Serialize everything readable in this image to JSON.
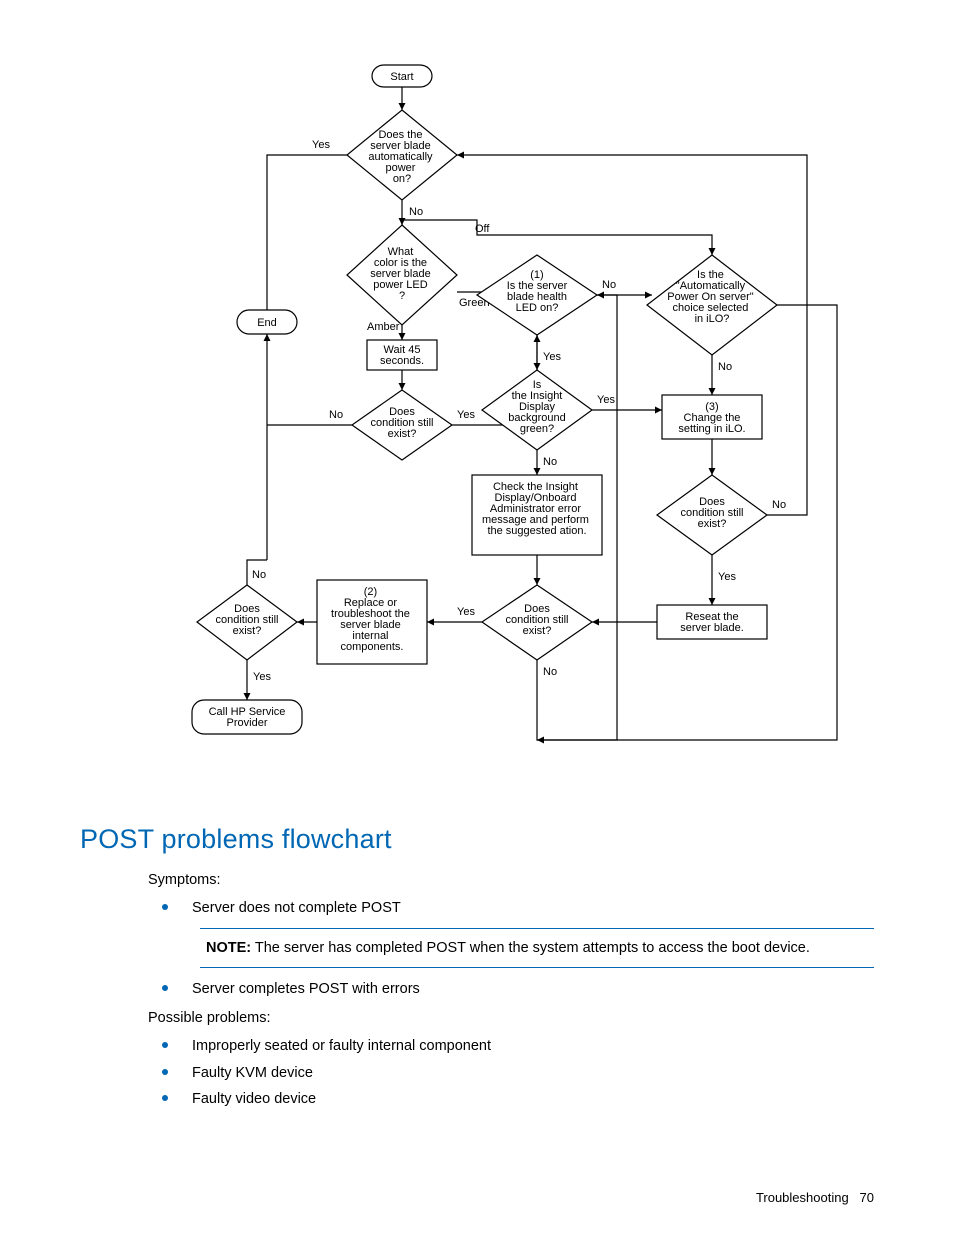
{
  "flow": {
    "start": "Start",
    "q_power_on": "Does the server blade automatically power on?",
    "q_power_on_yes": "Yes",
    "q_power_on_no": "No",
    "q_led_color": "What color is the server blade power LED ?",
    "led_off": "Off",
    "led_green": "Green",
    "led_amber": "Amber",
    "q_health_led": "(1) Is the server blade health LED on?",
    "health_yes": "Yes",
    "health_no": "No",
    "q_auto_ilo": "Is the \"Automatically Power On server\" choice selected in iLO?",
    "ilo_no": "No",
    "change_ilo": "(3) Change the setting in iLO.",
    "q_insight_green": "Is the Insight Display background green?",
    "insight_yes": "Yes",
    "insight_no": "No",
    "check_insight": "Check the Insight Display/Onboard Administrator error message and perform the suggested ation.",
    "q_cond1": "Does condition still exist?",
    "cond_yes": "Yes",
    "cond_no": "No",
    "reseat": "Reseat the server blade.",
    "replace": "(2) Replace or troubleshoot the server blade internal components.",
    "wait45": "Wait 45 seconds.",
    "q_cond2": "Does condition still exist?",
    "q_cond3": "Does condition still exist?",
    "q_cond4": "Does condition still exist?",
    "end": "End",
    "call_hp": "Call HP Service Provider",
    "yes": "Yes",
    "no": "No"
  },
  "section_title": "POST problems flowchart",
  "symptoms_label": "Symptoms:",
  "symptoms": [
    "Server does not complete POST",
    "Server completes POST with errors"
  ],
  "note_label": "NOTE:",
  "note_text": "  The server has completed POST when the system attempts to access the boot device.",
  "possible_label": "Possible problems:",
  "possible": [
    "Improperly seated or faulty internal component",
    "Faulty KVM device",
    "Faulty video device"
  ],
  "footer_section": "Troubleshooting",
  "footer_page": "70",
  "chart_data": {
    "type": "flowchart",
    "nodes": [
      {
        "id": "start",
        "shape": "terminator",
        "label": "Start"
      },
      {
        "id": "q_power_on",
        "shape": "decision",
        "label": "Does the server blade automatically power on?"
      },
      {
        "id": "q_led_color",
        "shape": "decision",
        "label": "What color is the server blade power LED ?"
      },
      {
        "id": "wait45",
        "shape": "process",
        "label": "Wait 45 seconds."
      },
      {
        "id": "q_cond_amber",
        "shape": "decision",
        "label": "Does condition still exist?"
      },
      {
        "id": "q_health_led",
        "shape": "decision",
        "label": "(1) Is the server blade health LED on?"
      },
      {
        "id": "q_auto_ilo",
        "shape": "decision",
        "label": "Is the \"Automatically Power On server\" choice selected in iLO?"
      },
      {
        "id": "change_ilo",
        "shape": "process",
        "label": "(3) Change the setting in iLO."
      },
      {
        "id": "q_cond_ilo",
        "shape": "decision",
        "label": "Does condition still exist?"
      },
      {
        "id": "q_insight_green",
        "shape": "decision",
        "label": "Is the Insight Display background green?"
      },
      {
        "id": "check_insight",
        "shape": "process",
        "label": "Check the Insight Display/Onboard Administrator error message and perform the suggested ation."
      },
      {
        "id": "q_cond_check",
        "shape": "decision",
        "label": "Does condition still exist?"
      },
      {
        "id": "reseat",
        "shape": "process",
        "label": "Reseat the server blade."
      },
      {
        "id": "replace",
        "shape": "process",
        "label": "(2) Replace or troubleshoot the server blade internal components."
      },
      {
        "id": "q_cond_replace",
        "shape": "decision",
        "label": "Does condition still exist?"
      },
      {
        "id": "end",
        "shape": "terminator",
        "label": "End"
      },
      {
        "id": "call_hp",
        "shape": "terminator",
        "label": "Call HP Service Provider"
      }
    ],
    "edges": [
      {
        "from": "start",
        "to": "q_power_on"
      },
      {
        "from": "q_power_on",
        "to": "end",
        "label": "Yes"
      },
      {
        "from": "q_power_on",
        "to": "q_led_color",
        "label": "No"
      },
      {
        "from": "q_led_color",
        "to": "q_auto_ilo",
        "label": "Off",
        "via": "top"
      },
      {
        "from": "q_led_color",
        "to": "q_health_led",
        "label": "Green"
      },
      {
        "from": "q_led_color",
        "to": "wait45",
        "label": "Amber"
      },
      {
        "from": "wait45",
        "to": "q_cond_amber"
      },
      {
        "from": "q_cond_amber",
        "to": "end",
        "label": "No"
      },
      {
        "from": "q_cond_amber",
        "to": "q_health_led",
        "label": "Yes"
      },
      {
        "from": "q_health_led",
        "to": "q_auto_ilo",
        "label": "No"
      },
      {
        "from": "q_health_led",
        "to": "q_insight_green",
        "label": "Yes"
      },
      {
        "from": "q_auto_ilo",
        "to": "change_ilo",
        "label": "No"
      },
      {
        "from": "q_auto_ilo",
        "to": "q_health_led",
        "label": "Yes",
        "via": "bottom-loop"
      },
      {
        "from": "change_ilo",
        "to": "q_cond_ilo"
      },
      {
        "from": "q_cond_ilo",
        "to": "end",
        "label": "No",
        "via": "far-right-top"
      },
      {
        "from": "q_cond_ilo",
        "to": "reseat",
        "label": "Yes"
      },
      {
        "from": "q_insight_green",
        "to": "change_ilo",
        "label": "Yes",
        "via": "right"
      },
      {
        "from": "q_insight_green",
        "to": "check_insight",
        "label": "No"
      },
      {
        "from": "check_insight",
        "to": "q_cond_check"
      },
      {
        "from": "reseat",
        "to": "q_cond_check"
      },
      {
        "from": "q_cond_check",
        "to": "replace",
        "label": "Yes"
      },
      {
        "from": "q_cond_check",
        "to": "q_health_led",
        "label": "No",
        "via": "bottom-loop"
      },
      {
        "from": "replace",
        "to": "q_cond_replace"
      },
      {
        "from": "q_cond_replace",
        "to": "end",
        "label": "No"
      },
      {
        "from": "q_cond_replace",
        "to": "call_hp",
        "label": "Yes"
      }
    ]
  }
}
